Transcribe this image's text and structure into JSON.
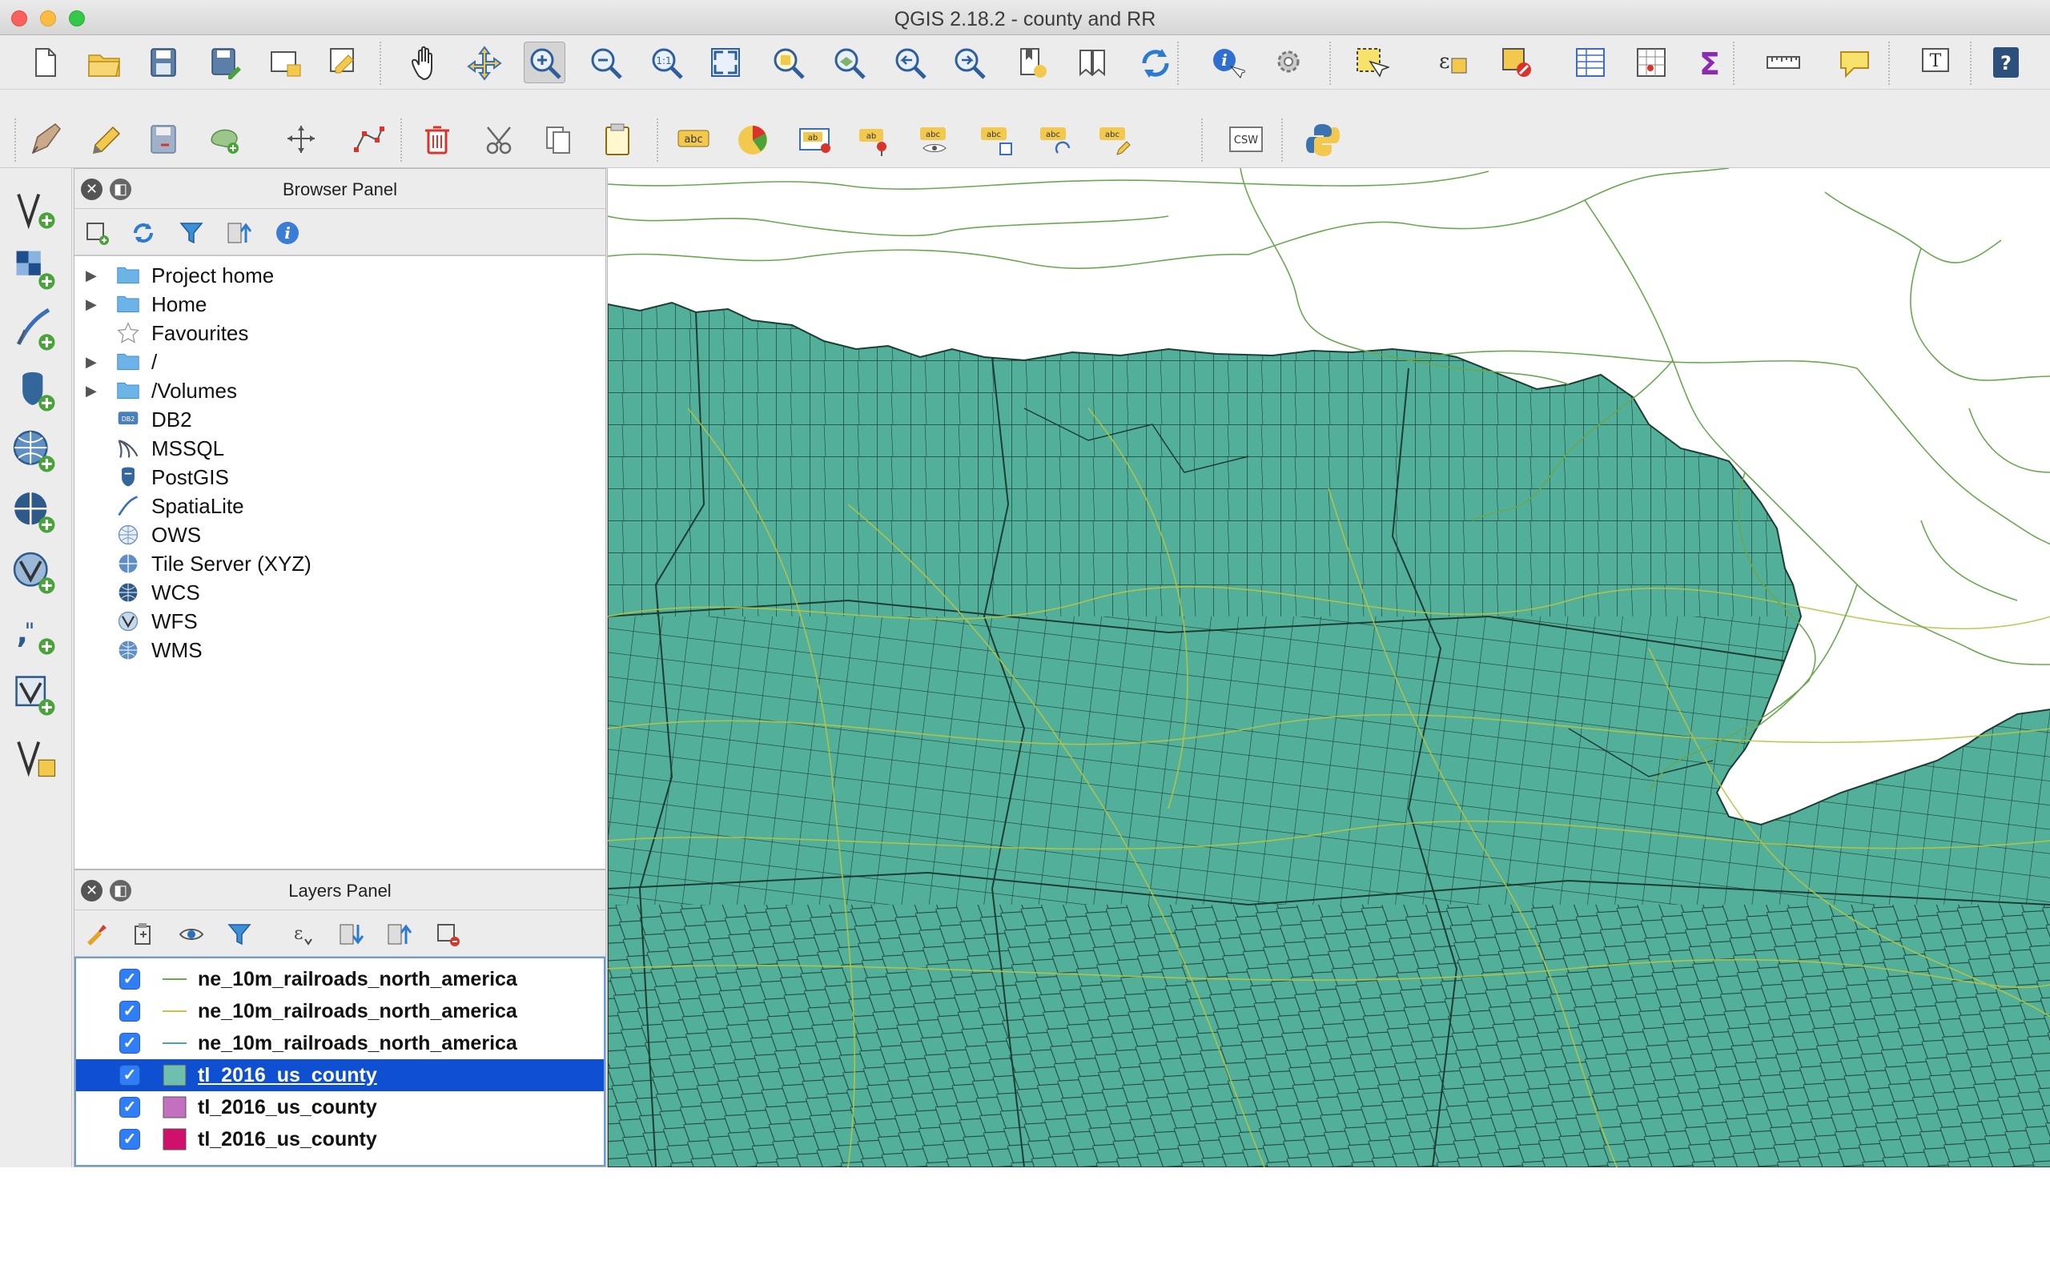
{
  "window": {
    "title": "QGIS 2.18.2 - county and RR"
  },
  "colors": {
    "accent_selection": "#0f4fd2",
    "county_fill": "#52b09a",
    "county_outline": "#1d3d33",
    "railroad_green": "#6aa84f",
    "railroad_yellow": "#b8c544"
  },
  "toolbar_main": {
    "icons": [
      "new-project-icon",
      "open-project-icon",
      "save-project-icon",
      "save-as-icon",
      "print-composer-icon",
      "composer-manager-icon",
      "pan-icon",
      "pan-to-selection-icon",
      "zoom-in-icon",
      "zoom-out-icon",
      "zoom-actual-icon",
      "zoom-full-icon",
      "zoom-selection-icon",
      "zoom-layer-icon",
      "zoom-last-icon",
      "zoom-next-icon",
      "new-bookmark-icon",
      "show-bookmarks-icon",
      "refresh-icon",
      "identify-icon",
      "run-action-icon",
      "select-features-icon",
      "select-expression-icon",
      "deselect-icon",
      "attribute-table-icon",
      "field-calculator-icon",
      "statistics-icon",
      "measure-icon",
      "map-tips-icon",
      "text-annotation-icon",
      "help-icon"
    ]
  },
  "toolbar_edit": {
    "icons": [
      "current-edits-icon",
      "toggle-editing-icon",
      "save-edits-icon",
      "add-feature-icon",
      "move-feature-icon",
      "node-tool-icon",
      "delete-selected-icon",
      "cut-features-icon",
      "copy-features-icon",
      "paste-features-icon",
      "label-icon",
      "diagram-icon",
      "layer-labeling-icon",
      "pin-labels-icon",
      "show-hide-labels-icon",
      "move-label-icon",
      "rotate-label-icon",
      "change-label-icon",
      "metasearch-icon",
      "python-console-icon"
    ],
    "csw_label": "CSW"
  },
  "left_toolbar": {
    "icons": [
      "add-vector-layer-icon",
      "add-raster-layer-icon",
      "add-spatialite-layer-icon",
      "add-postgis-layer-icon",
      "add-wms-layer-icon",
      "add-wcs-layer-icon",
      "add-wfs-layer-icon",
      "add-delimited-text-icon",
      "add-virtual-layer-icon",
      "new-shapefile-icon"
    ]
  },
  "browser_panel": {
    "title": "Browser Panel",
    "items": [
      {
        "label": "Project home",
        "expandable": true,
        "icon": "folder-icon"
      },
      {
        "label": "Home",
        "expandable": true,
        "icon": "folder-icon"
      },
      {
        "label": "Favourites",
        "expandable": false,
        "icon": "star-icon"
      },
      {
        "label": "/",
        "expandable": true,
        "icon": "folder-icon"
      },
      {
        "label": "/Volumes",
        "expandable": true,
        "icon": "folder-icon"
      },
      {
        "label": "DB2",
        "expandable": false,
        "icon": "db2-icon"
      },
      {
        "label": "MSSQL",
        "expandable": false,
        "icon": "mssql-icon"
      },
      {
        "label": "PostGIS",
        "expandable": false,
        "icon": "postgis-icon"
      },
      {
        "label": "SpatiaLite",
        "expandable": false,
        "icon": "spatialite-icon"
      },
      {
        "label": "OWS",
        "expandable": false,
        "icon": "ows-icon"
      },
      {
        "label": "Tile Server (XYZ)",
        "expandable": false,
        "icon": "tile-server-icon"
      },
      {
        "label": "WCS",
        "expandable": false,
        "icon": "wcs-icon"
      },
      {
        "label": "WFS",
        "expandable": false,
        "icon": "wfs-icon"
      },
      {
        "label": "WMS",
        "expandable": false,
        "icon": "wms-icon"
      }
    ]
  },
  "layers_panel": {
    "title": "Layers Panel",
    "layers": [
      {
        "name": "ne_10m_railroads_north_america",
        "checked": true,
        "symbol": "line",
        "color": "#6aa84f",
        "selected": false
      },
      {
        "name": "ne_10m_railroads_north_america",
        "checked": true,
        "symbol": "line",
        "color": "#c8c24a",
        "selected": false
      },
      {
        "name": "ne_10m_railroads_north_america",
        "checked": true,
        "symbol": "line",
        "color": "#4aa6a0",
        "selected": false
      },
      {
        "name": "tl_2016_us_county",
        "checked": true,
        "symbol": "fill",
        "color": "#6fbfae",
        "selected": true
      },
      {
        "name": "tl_2016_us_county",
        "checked": true,
        "symbol": "fill",
        "color": "#c46fc0",
        "selected": false
      },
      {
        "name": "tl_2016_us_county",
        "checked": true,
        "symbol": "fill",
        "color": "#d0106a",
        "selected": false
      }
    ]
  }
}
